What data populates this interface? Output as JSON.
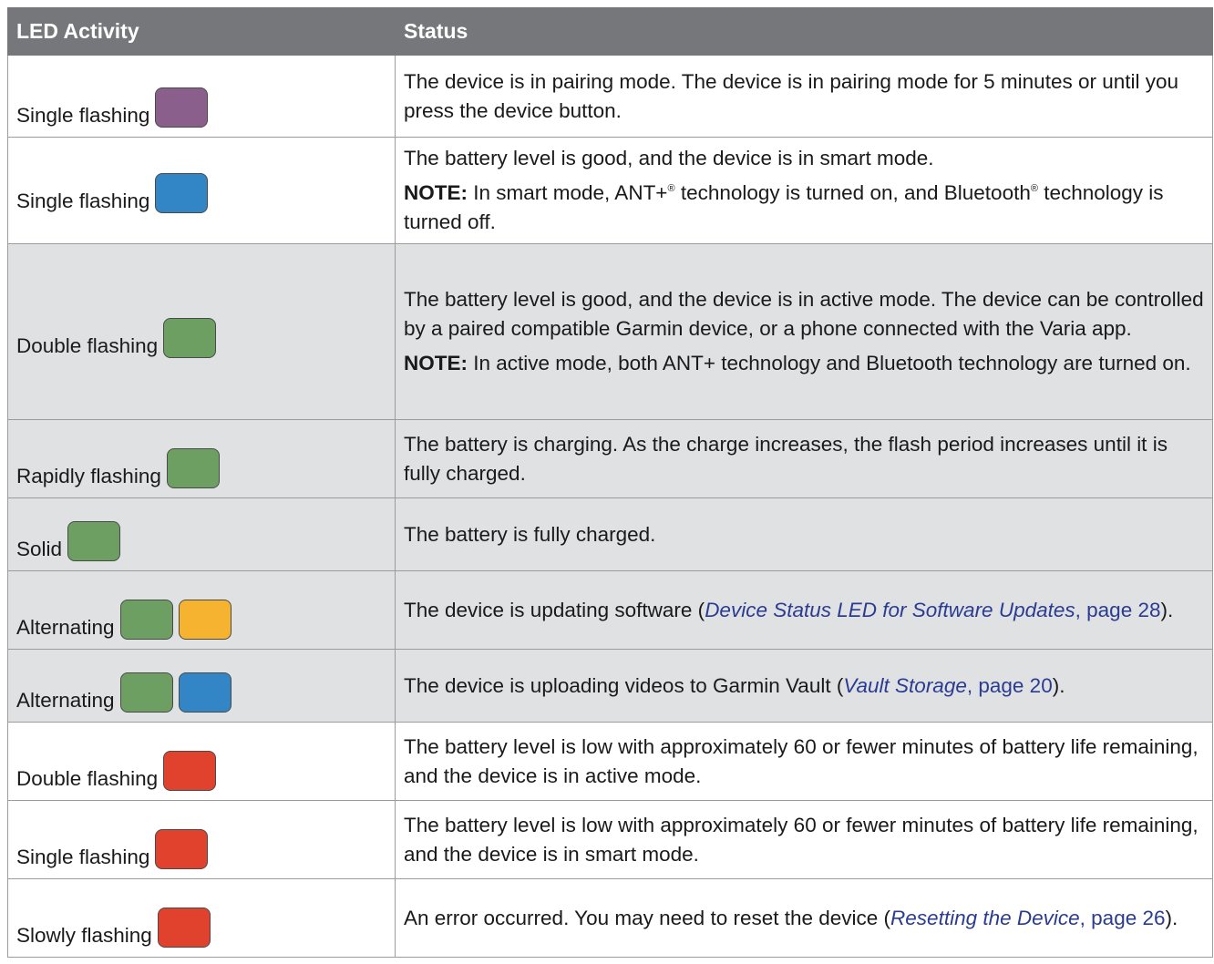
{
  "headers": {
    "activity": "LED Activity",
    "status": "Status"
  },
  "colors": {
    "purple": "#8b5f8b",
    "blue": "#3386c6",
    "green": "#6e9f62",
    "amber": "#f6b330",
    "red": "#e0422e"
  },
  "rows": [
    {
      "activity": "Single flashing",
      "leds": [
        "purple"
      ],
      "status": "The device is in pairing mode. The device is in pairing mode for 5 minutes or until you press the device button."
    },
    {
      "activity": "Single flashing",
      "leds": [
        "blue"
      ],
      "status": "The battery level is good, and the device is in smart mode.",
      "note_label": "NOTE:",
      "note_a": " In smart mode, ANT+",
      "note_b": " technology is turned on, and Bluetooth",
      "note_c": " technology is turned off.",
      "reg": "®"
    },
    {
      "activity": "Double flashing",
      "leds": [
        "green"
      ],
      "status": "The battery level is good, and the device is in active mode. The device can be controlled by a paired compatible Garmin device, or a phone connected with the Varia app.",
      "note_label": "NOTE:",
      "note": " In active mode, both ANT+ technology and Bluetooth technology are turned on."
    },
    {
      "activity": "Rapidly flashing",
      "leds": [
        "green"
      ],
      "status": "The battery is charging. As the charge increases, the flash period increases until it is fully charged."
    },
    {
      "activity": "Solid",
      "leds": [
        "green"
      ],
      "status": "The battery is fully charged."
    },
    {
      "activity": "Alternating",
      "leds": [
        "green",
        "amber"
      ],
      "status_pre": "The device is updating software (",
      "ref": "Device Status LED for Software Updates",
      "sep": ", ",
      "page": "page 28",
      "status_post": ")."
    },
    {
      "activity": "Alternating",
      "leds": [
        "green",
        "blue"
      ],
      "status_pre": "The device is uploading videos to Garmin Vault (",
      "ref": "Vault Storage",
      "sep": ", ",
      "page": "page 20",
      "status_post": ")."
    },
    {
      "activity": "Double flashing",
      "leds": [
        "red"
      ],
      "status": "The battery level is low with approximately 60 or fewer minutes of battery life remaining, and the device is in active mode."
    },
    {
      "activity": "Single flashing",
      "leds": [
        "red"
      ],
      "status": "The battery level is low with approximately 60 or fewer minutes of battery life remaining, and the device is in smart mode."
    },
    {
      "activity": "Slowly flashing",
      "leds": [
        "red"
      ],
      "status_pre": "An error occurred. You may need to reset the device (",
      "ref": "Resetting the Device",
      "sep": ", ",
      "page": "page 26",
      "status_post": ")."
    }
  ]
}
